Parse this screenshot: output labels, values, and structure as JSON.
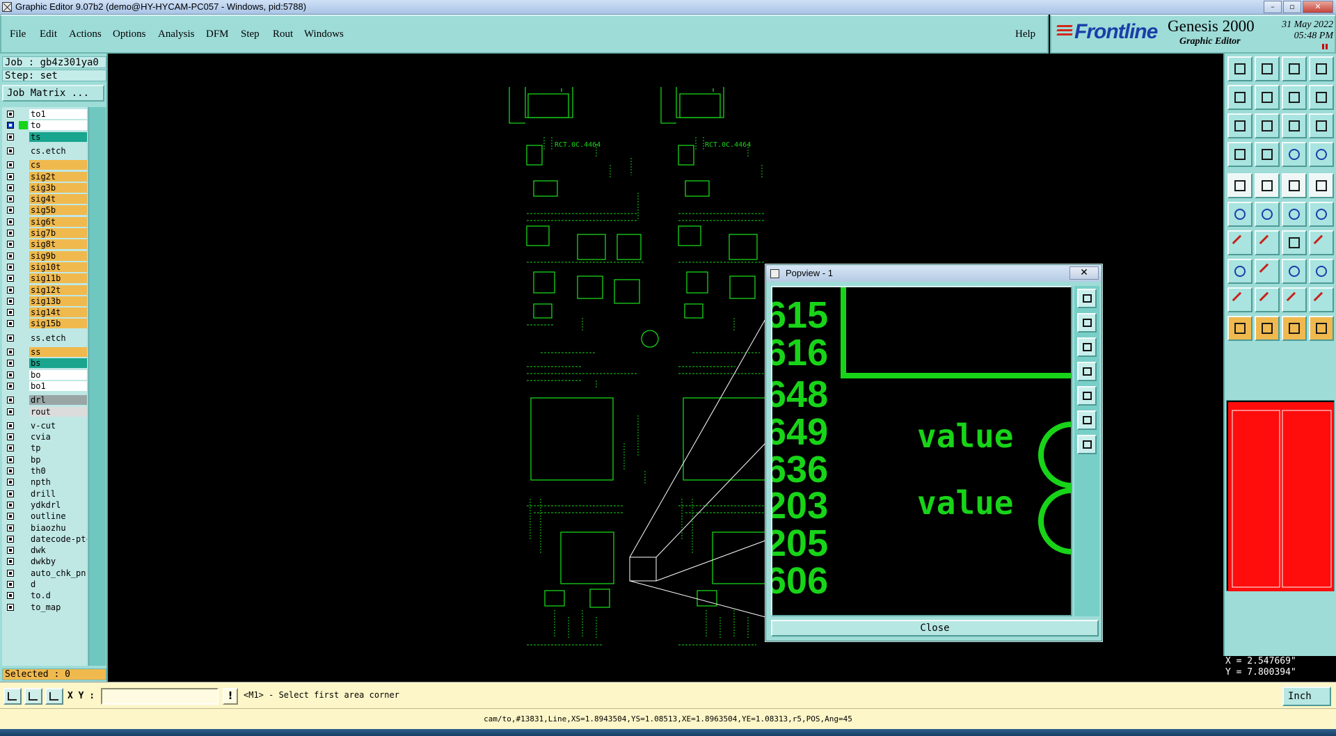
{
  "window": {
    "title": "Graphic Editor 9.07b2 (demo@HY-HYCAM-PC057 - Windows, pid:5788)",
    "controls": [
      "–",
      "▫",
      "✕"
    ]
  },
  "menu": {
    "items": [
      "File",
      "Edit",
      "Actions",
      "Options",
      "Analysis",
      "DFM",
      "Step",
      "Rout",
      "Windows"
    ],
    "help": "Help"
  },
  "brand": {
    "logo": "Frontline",
    "product": "Genesis 2000",
    "subtitle": "Graphic Editor",
    "date": "31 May 2022",
    "time": "05:48 PM"
  },
  "job": {
    "job_label": "Job : gb4z301ya0",
    "step_label": "Step: set",
    "job_matrix": "Job Matrix ..."
  },
  "layers": [
    {
      "name": "to1",
      "color": "#ffffff",
      "on": false
    },
    {
      "name": "to",
      "color": "#ffffff",
      "on": true
    },
    {
      "name": "ts",
      "color": "#1aa58f",
      "on": false
    },
    {
      "name": "cs.etch",
      "color": "#bfe8e5",
      "on": false
    },
    {
      "name": "cs",
      "color": "#f0b94e",
      "on": false
    },
    {
      "name": "sig2t",
      "color": "#f0b94e",
      "on": false
    },
    {
      "name": "sig3b",
      "color": "#f0b94e",
      "on": false
    },
    {
      "name": "sig4t",
      "color": "#f0b94e",
      "on": false
    },
    {
      "name": "sig5b",
      "color": "#f0b94e",
      "on": false
    },
    {
      "name": "sig6t",
      "color": "#f0b94e",
      "on": false
    },
    {
      "name": "sig7b",
      "color": "#f0b94e",
      "on": false
    },
    {
      "name": "sig8t",
      "color": "#f0b94e",
      "on": false
    },
    {
      "name": "sig9b",
      "color": "#f0b94e",
      "on": false
    },
    {
      "name": "sig10t",
      "color": "#f0b94e",
      "on": false
    },
    {
      "name": "sig11b",
      "color": "#f0b94e",
      "on": false
    },
    {
      "name": "sig12t",
      "color": "#f0b94e",
      "on": false
    },
    {
      "name": "sig13b",
      "color": "#f0b94e",
      "on": false
    },
    {
      "name": "sig14t",
      "color": "#f0b94e",
      "on": false
    },
    {
      "name": "sig15b",
      "color": "#f0b94e",
      "on": false
    },
    {
      "name": "ss.etch",
      "color": "#bfe8e5",
      "on": false
    },
    {
      "name": "ss",
      "color": "#f0b94e",
      "on": false
    },
    {
      "name": "bs",
      "color": "#1aa58f",
      "on": false
    },
    {
      "name": "bo",
      "color": "#ffffff",
      "on": false
    },
    {
      "name": "bo1",
      "color": "#ffffff",
      "on": false
    },
    {
      "name": "drl",
      "color": "#9aa6a6",
      "on": false
    },
    {
      "name": "rout",
      "color": "#dcdcdc",
      "on": false
    },
    {
      "name": "v-cut",
      "color": "#bfe8e5",
      "on": false
    },
    {
      "name": "cvia",
      "color": "#bfe8e5",
      "on": false
    },
    {
      "name": "tp",
      "color": "#bfe8e5",
      "on": false
    },
    {
      "name": "bp",
      "color": "#bfe8e5",
      "on": false
    },
    {
      "name": "th0",
      "color": "#bfe8e5",
      "on": false
    },
    {
      "name": "npth",
      "color": "#bfe8e5",
      "on": false
    },
    {
      "name": "drill",
      "color": "#bfe8e5",
      "on": false
    },
    {
      "name": "ydkdrl",
      "color": "#bfe8e5",
      "on": false
    },
    {
      "name": "outline",
      "color": "#bfe8e5",
      "on": false
    },
    {
      "name": "biaozhu",
      "color": "#bfe8e5",
      "on": false
    },
    {
      "name": "datecode-ptc",
      "color": "#bfe8e5",
      "on": false
    },
    {
      "name": "dwk",
      "color": "#bfe8e5",
      "on": false
    },
    {
      "name": "dwkby",
      "color": "#bfe8e5",
      "on": false
    },
    {
      "name": "auto_chk_pn",
      "color": "#bfe8e5",
      "on": false
    },
    {
      "name": "d",
      "color": "#bfe8e5",
      "on": false
    },
    {
      "name": "to.d",
      "color": "#bfe8e5",
      "on": false
    },
    {
      "name": "to_map",
      "color": "#bfe8e5",
      "on": false
    }
  ],
  "selected": "Selected : 0",
  "popview": {
    "title": "Popview - 1",
    "close_x": "✕",
    "close_button": "Close",
    "labels": [
      "615",
      "616",
      "648",
      "649",
      "636",
      "203",
      "205",
      "606"
    ],
    "values": [
      "value",
      "value"
    ]
  },
  "coords": {
    "x": "X = 2.547669\"",
    "y": "Y = 7.800394\""
  },
  "command": {
    "xy_label": "X Y :",
    "xy_value": "",
    "info_icon": "!",
    "prompt": "<M1> - Select first area corner",
    "unit": "Inch"
  },
  "status": "cam/to,#13831,Line,XS=1.8943504,YS=1.08513,XE=1.8963504,YE=1.08313,r5,POS,Ang=45",
  "colors": {
    "panel": "#9edcd8",
    "signal_layer": "#f0b94e",
    "board_graphics": "#18d418",
    "background": "#000000",
    "nav_map": "#ff0c0c"
  }
}
